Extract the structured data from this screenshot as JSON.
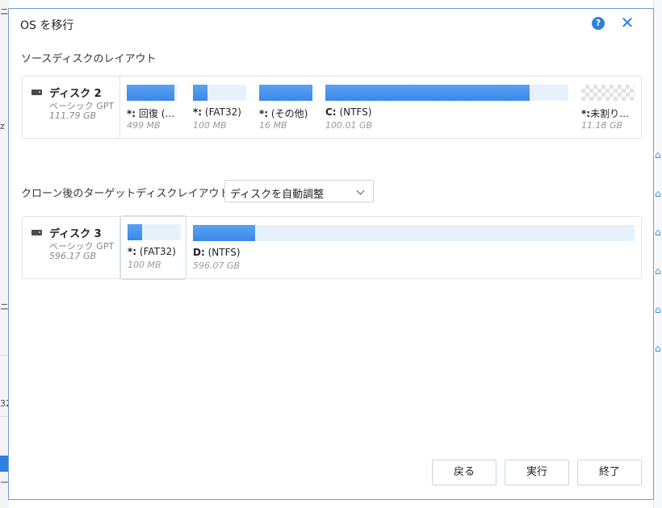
{
  "dialog": {
    "title": "OS を移行",
    "help_icon": "?",
    "close_icon": "✕"
  },
  "source": {
    "label": "ソースディスクのレイアウト",
    "disk": {
      "name": "ディスク 2",
      "type": "ベーシック GPT",
      "size": "111.79 GB"
    },
    "partitions": [
      {
        "drive": "*:",
        "label": "回復 (…",
        "size": "499 MB",
        "fill": 0.95
      },
      {
        "drive": "*:",
        "label": "(FAT32)",
        "size": "100 MB",
        "fill": 0.28
      },
      {
        "drive": "*:",
        "label": "(その他)",
        "size": "16 MB",
        "fill": 1.0
      },
      {
        "drive": "C:",
        "label": "(NTFS)",
        "size": "100.01 GB",
        "fill": 0.84
      },
      {
        "drive": "*:",
        "label": "未割り…",
        "size": "11.18 GB",
        "fill": 0
      }
    ]
  },
  "target": {
    "label": "クローン後のターゲットディスクレイアウト",
    "dropdown": {
      "selected": "ディスクを自動調整"
    },
    "disk": {
      "name": "ディスク 3",
      "type": "ベーシック GPT",
      "size": "596.17 GB"
    },
    "partitions": [
      {
        "drive": "*:",
        "label": "(FAT32)",
        "size": "100 MB",
        "fill": 0.28
      },
      {
        "drive": "D:",
        "label": "(NTFS)",
        "size": "596.07 GB",
        "fill": 0.14
      }
    ]
  },
  "buttons": {
    "back": "戻る",
    "execute": "実行",
    "finish": "終了"
  },
  "background": {
    "left_fragments": [
      "ニー",
      "z",
      "ニー",
      "32",
      "ー",
      "ー"
    ],
    "right_icons": [
      "⌂",
      "⌂",
      "⌂",
      "⌂",
      "⌂",
      "⌂"
    ]
  },
  "colors": {
    "accent": "#2a80e0",
    "bar_fill": "#3b87e8",
    "bar_empty": "#e7f1fc"
  }
}
